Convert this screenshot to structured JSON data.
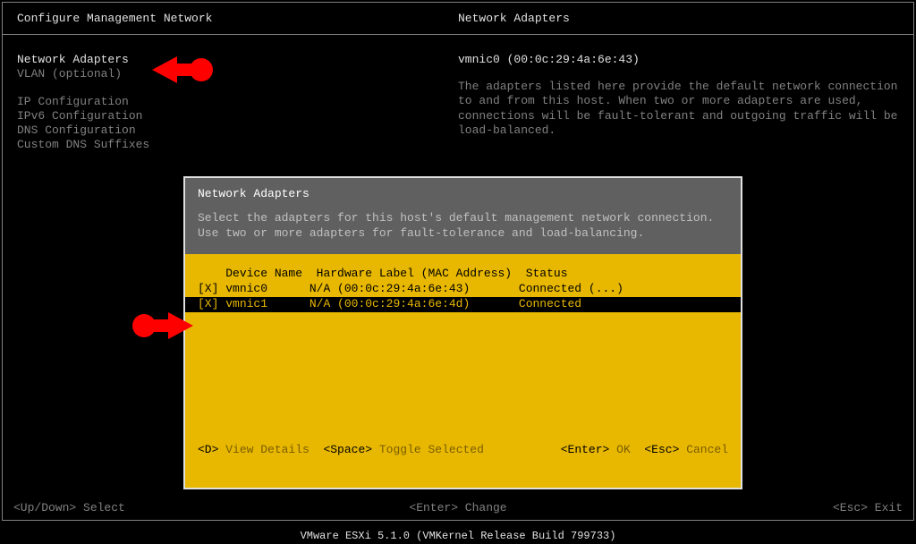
{
  "header": {
    "left": "Configure Management Network",
    "right": "Network Adapters"
  },
  "leftMenu": {
    "items": [
      "Network Adapters",
      "VLAN (optional)",
      "",
      "IP Configuration",
      "IPv6 Configuration",
      "DNS Configuration",
      "Custom DNS Suffixes"
    ],
    "activeIndex": 0
  },
  "rightPanel": {
    "title": "vmnic0 (00:0c:29:4a:6e:43)",
    "body": "The adapters listed here provide the default network connection to and from this host. When two or more adapters are used, connections will be fault-tolerant and outgoing traffic will be load-balanced."
  },
  "dialog": {
    "title": "Network Adapters",
    "description": "Select the adapters for this host's default management network connection. Use two or more adapters for fault-tolerance and load-balancing.",
    "columns": {
      "c1": "Device Name",
      "c2": "Hardware Label (MAC Address)",
      "c3": "Status"
    },
    "rows": [
      {
        "checked": "[X]",
        "name": "vmnic0",
        "label": "N/A (00:0c:29:4a:6e:43)",
        "status": "Connected (...)",
        "selected": false
      },
      {
        "checked": "[X]",
        "name": "vmnic1",
        "label": "N/A (00:0c:29:4a:6e:4d)",
        "status": "Connected",
        "selected": true
      }
    ],
    "footer": {
      "dKey": "<D>",
      "dLabel": "View Details",
      "spaceKey": "<Space>",
      "spaceLabel": "Toggle Selected",
      "enterKey": "<Enter>",
      "enterLabel": "OK",
      "escKey": "<Esc>",
      "escLabel": "Cancel"
    }
  },
  "statusBar": {
    "left": "<Up/Down> Select",
    "center": "<Enter> Change",
    "right": "<Esc> Exit"
  },
  "version": "VMware ESXi 5.1.0 (VMKernel Release Build 799733)"
}
